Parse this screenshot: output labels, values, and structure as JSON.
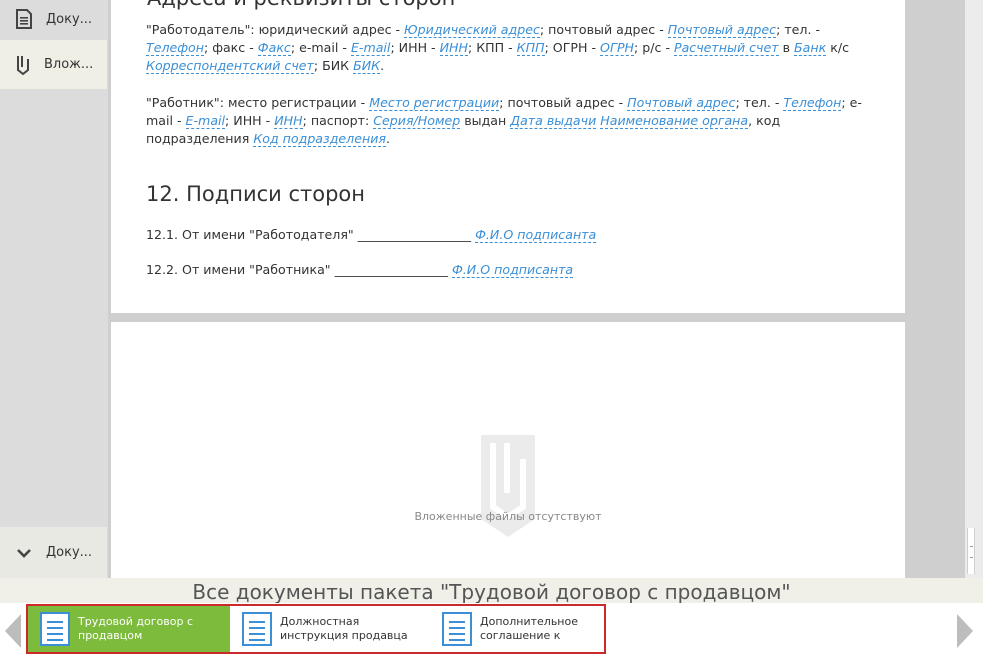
{
  "sidebar": {
    "items": [
      {
        "label": "Доку...",
        "icon": "document-icon"
      },
      {
        "label": "Влож...",
        "icon": "paperclip-icon"
      },
      {
        "label": "Доку...",
        "icon": "chevron-down-icon"
      }
    ]
  },
  "document": {
    "cut_heading": "Адреса и реквизиты сторон",
    "employer_paragraph": {
      "intro": "\"Работодатель\": юридический адрес - ",
      "legal_address": "Юридический адрес",
      "t1": "; почтовый адрес - ",
      "postal_address": "Почтовый адрес",
      "t2": "; тел. - ",
      "phone": "Телефон",
      "t3": "; факс - ",
      "fax": "Факс",
      "t4": "; e-mail - ",
      "email": "E-mail",
      "t5": "; ИНН - ",
      "inn": "ИНН",
      "t6": "; КПП - ",
      "kpp": "КПП",
      "t7": "; ОГРН - ",
      "ogrn": "ОГРН",
      "t8": "; р/с - ",
      "account": "Расчетный счет",
      "t9": " в ",
      "bank": "Банк",
      "t10": " к/с ",
      "corr_account": "Корреспондентский счет",
      "t11": "; БИК ",
      "bik": "БИК",
      "t12": "."
    },
    "employee_paragraph": {
      "intro": "\"Работник\": место регистрации - ",
      "registration": "Место регистрации",
      "t1": "; почтовый адрес - ",
      "postal_address": "Почтовый адрес",
      "t2": "; тел. - ",
      "phone": "Телефон",
      "t3": "; e-mail - ",
      "email": "E-mail",
      "t4": "; ИНН - ",
      "inn": "ИНН",
      "t5": "; паспорт: ",
      "passport": "Серия/Номер",
      "t6": " выдан ",
      "issue_date": "Дата выдачи",
      "t7": " ",
      "issuer": "Наименование органа",
      "t8": ", код подразделения ",
      "dept_code": "Код подразделения",
      "t9": "."
    },
    "section_title": "12. Подписи сторон",
    "signatures": [
      {
        "text": "12.1.  От имени \"Работодателя\" __________________ ",
        "field": "Ф.И.О подписанта"
      },
      {
        "text": "12.2.  От имени \"Работника\" __________________ ",
        "field": "Ф.И.О подписанта"
      }
    ]
  },
  "attachments": {
    "empty_text": "Вложенные файлы отсутствуют"
  },
  "package": {
    "title": "Все документы пакета \"Трудовой договор с продавцом\"",
    "documents": [
      {
        "name_line1": "Трудовой договор с",
        "name_line2": "продавцом"
      },
      {
        "name_line1": "Должностная",
        "name_line2": "инструкция продавца"
      },
      {
        "name_line1": "Дополнительное",
        "name_line2": "соглашение к"
      }
    ]
  },
  "colors": {
    "accent_green": "#7dbb3c",
    "field_blue": "#3a8fd6",
    "highlight_red": "#cc2a2a"
  }
}
